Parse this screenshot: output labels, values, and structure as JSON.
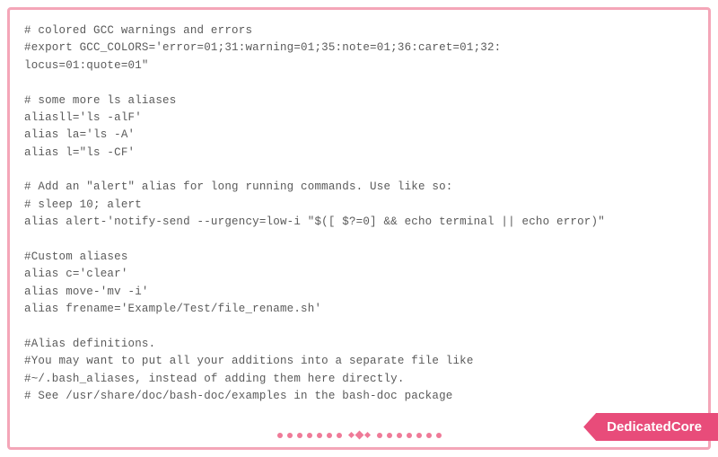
{
  "lines": [
    "# colored GCC warnings and errors",
    "#export GCC_COLORS='error=01;31:warning=01;35:note=01;36:caret=01;32:",
    "locus=01:quote=01\"",
    "",
    "# some more ls aliases",
    "aliasll='ls -alF'",
    "alias la='ls -A'",
    "alias l=\"ls -CF'",
    "",
    "# Add an \"alert\" alias for long running commands. Use like so:",
    "# sleep 10; alert",
    "alias alert-'notify-send --urgency=low-i \"$([ $?=0] && echo terminal || echo error)\"",
    "",
    "#Custom aliases",
    "alias c='clear'",
    "alias move-'mv -i'",
    "alias frename='Example/Test/file_rename.sh'",
    "",
    "#Alias definitions.",
    "#You may want to put all your additions into a separate file like",
    "#~/.bash_aliases, instead of adding them here directly.",
    "# See /usr/share/doc/bash-doc/examples in the bash-doc package"
  ],
  "badge_label": "DedicatedCore"
}
